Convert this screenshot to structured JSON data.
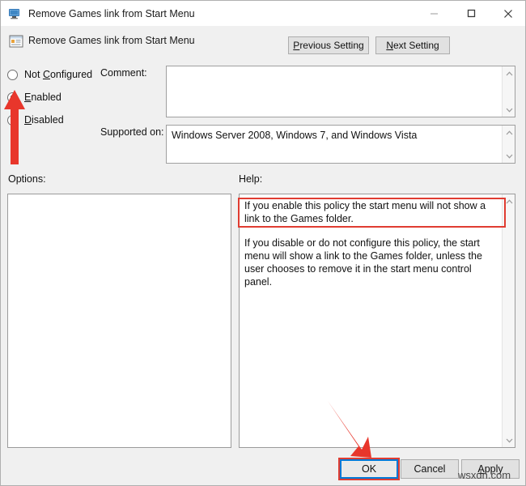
{
  "window": {
    "title": "Remove Games link from Start Menu",
    "icon": "computer-monitor-icon",
    "controls": {
      "minimize": "minimize-icon",
      "maximize": "maximize-icon",
      "close": "close-icon"
    }
  },
  "header": {
    "policy_icon": "group-policy-setting-icon",
    "policy_title": "Remove Games link from Start Menu",
    "previous_setting_label": "Previous Setting",
    "previous_setting_accel": "P",
    "next_setting_label": "Next Setting",
    "next_setting_accel": "N"
  },
  "state_options": {
    "not_configured": {
      "label": "Not Configured",
      "accel": "C",
      "selected": false
    },
    "enabled": {
      "label": "Enabled",
      "accel": "E",
      "selected": true
    },
    "disabled": {
      "label": "Disabled",
      "accel": "D",
      "selected": false
    }
  },
  "fields": {
    "comment_label": "Comment:",
    "comment_value": "",
    "supported_label": "Supported on:",
    "supported_value": "Windows Server 2008, Windows 7, and Windows Vista"
  },
  "panels": {
    "options_label": "Options:",
    "options_content": "",
    "help_label": "Help:",
    "help_paragraph_1": "If you enable this policy the start menu will not show a link to the Games folder.",
    "help_paragraph_2": "If you disable or do not configure this policy, the start menu will show a link to the Games folder, unless the user chooses to remove it in the start menu control panel."
  },
  "buttons": {
    "ok": "OK",
    "cancel": "Cancel",
    "apply": "Apply",
    "apply_accel": "A"
  },
  "annotations": {
    "arrow_color": "#e03c31",
    "highlight_color": "#e03c31",
    "focus_color": "#0078d7",
    "arrow_to_enabled": "red-arrow-up-icon",
    "arrow_to_ok": "red-arrow-down-right-icon",
    "help_highlight": "red-rectangle-highlight",
    "ok_highlight": "red-rectangle-highlight"
  },
  "watermark": {
    "text": "wsxdn.com"
  }
}
